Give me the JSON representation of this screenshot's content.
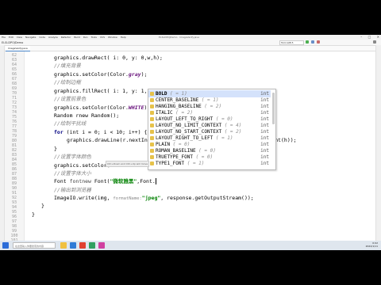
{
  "app": {
    "menu": [
      "File",
      "Edit",
      "View",
      "Navigate",
      "Code",
      "Analyze",
      "Refactor",
      "Build",
      "Run",
      "Tools",
      "VCS",
      "Window",
      "Help"
    ],
    "window_title": "ELSLDPOJDemo · ImageVerify.java",
    "breadcrumb": "ELSLDPOJDemo",
    "run_config": "Tomcat8.5"
  },
  "tabs": [
    {
      "label": "ImageVerify.java"
    }
  ],
  "editor": {
    "line_numbers": [
      "62",
      "63",
      "64",
      "65",
      "66",
      "67",
      "68",
      "69",
      "70",
      "71",
      "72",
      "73",
      "74",
      "75",
      "76",
      "77",
      "78",
      "79",
      "80",
      "81",
      "82",
      "83",
      "84",
      "85",
      "86",
      "87",
      "88",
      "89",
      "90",
      "91",
      "92",
      "93",
      "94",
      "95",
      "96",
      "97",
      "98",
      "99",
      "100",
      "101"
    ],
    "lines": {
      "l1": {
        "text": "graphics.drawRect( i: 0, y: 0,w,h);"
      },
      "l2": {
        "text": "//填充背景"
      },
      "l3": {
        "pre": "graphics.setColor(Color.",
        "field": "gray",
        "post": ");"
      },
      "l4": {
        "text": "//绘制边框"
      },
      "l5": {
        "text": "graphics.fillRect( i: 1, y: 1, width: w-2, height: h-2);"
      },
      "l6": {
        "text": "//设置前景色"
      },
      "l7": {
        "pre": "graphics.setColor(Color.",
        "field": "WHITE",
        "post": ");"
      },
      "l8": {
        "kw": "Random ",
        "rest": "rnew Random();"
      },
      "l9": {
        "text": "//绘制干扰线"
      },
      "l10": {
        "kw": "for ",
        "rest": "(int i = 0; i < 10; i++) {"
      },
      "l11": {
        "text": "graphics.drawLine(r.nextInt(w), r.nextInt(h), r.nextInt(w), r.nextInt(h));"
      },
      "l12": {
        "text": "}"
      },
      "l13": {
        "text": "//设置字体颜色"
      },
      "l14": {
        "pre": "graphics.setColor(Color.",
        "field": "",
        "post": ""
      },
      "l15": {
        "text": "//设置字体大小"
      },
      "l16": {
        "pre": "Font ",
        "var": "fontnew",
        "mid": " Font(",
        "str": "\"微软雅黑\"",
        "post": ",Font."
      },
      "l17": {
        "text": "//输出到浏览器"
      },
      "l18": {
        "pre": "ImageIO.write(img, ",
        "hint": "formatName:",
        "str": "\"jpeg\"",
        "post": ", response.getOutputStream());"
      },
      "l19": {
        "text": "}"
      },
      "l20": {
        "text": "}"
      }
    }
  },
  "completion": {
    "items": [
      {
        "name": "BOLD",
        "value": " ( = 1)",
        "type": "int",
        "selected": true
      },
      {
        "name": "CENTER_BASELINE",
        "value": " ( = 1)",
        "type": "int"
      },
      {
        "name": "HANGING_BASELINE",
        "value": " ( = 2)",
        "type": "int"
      },
      {
        "name": "ITALIC",
        "value": " ( = 2)",
        "type": "int"
      },
      {
        "name": "LAYOUT_LEFT_TO_RIGHT",
        "value": " ( = 0)",
        "type": "int"
      },
      {
        "name": "LAYOUT_NO_LIMIT_CONTEXT",
        "value": " ( = 4)",
        "type": "int"
      },
      {
        "name": "LAYOUT_NO_START_CONTEXT",
        "value": " ( = 2)",
        "type": "int"
      },
      {
        "name": "LAYOUT_RIGHT_TO_LEFT",
        "value": " ( = 1)",
        "type": "int"
      },
      {
        "name": "PLAIN",
        "value": " ( = 0)",
        "type": "int"
      },
      {
        "name": "ROMAN_BASELINE",
        "value": " ( = 0)",
        "type": "int"
      },
      {
        "name": "TRUETYPE_FONT",
        "value": " ( = 0)",
        "type": "int"
      },
      {
        "name": "TYPE1_FONT",
        "value": " ( = 1)",
        "type": "int"
      }
    ],
    "footer": "Ctrl+Down and Ctrl+Up will move caret down and up in the editor"
  },
  "bottom_tools": [
    "6: TODO",
    "4: Problems",
    "Terminal",
    "Java Enterprise",
    "Build"
  ],
  "status": {
    "message": "Expression expected",
    "position": "81:47  CRLF  UTF-8  4 spaces"
  },
  "taskbar": {
    "search_placeholder": "在这里输入你要搜索的内容",
    "time": "0:02",
    "date": "2022/1/11"
  }
}
